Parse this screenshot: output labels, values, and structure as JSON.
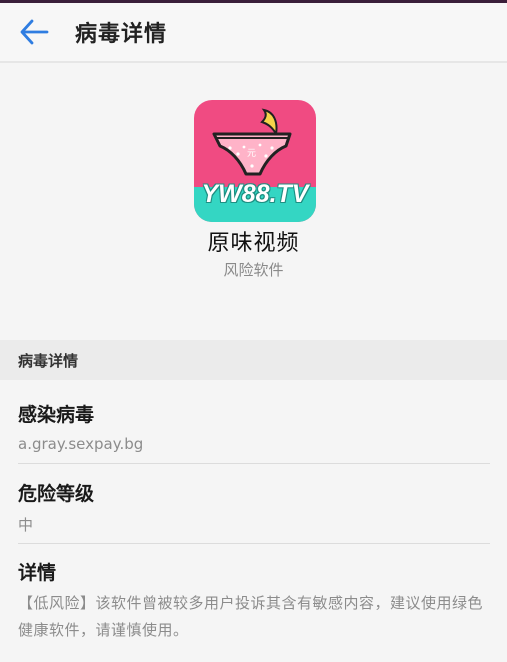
{
  "header": {
    "title": "病毒详情"
  },
  "app": {
    "icon_brand_text": "YW88.TV",
    "name": "原味视频",
    "risk_label": "风险软件"
  },
  "section": {
    "title": "病毒详情"
  },
  "details": {
    "infection": {
      "label": "感染病毒",
      "value": "a.gray.sexpay.bg"
    },
    "risk_level": {
      "label": "危险等级",
      "value": "中"
    },
    "description": {
      "label": "详情",
      "value": "【低风险】该软件曾被较多用户投诉其含有敏感内容，建议使用绿色健康软件，请谨慎使用。"
    }
  },
  "colors": {
    "back_arrow": "#2f7de1",
    "icon_pink": "#f04b82",
    "icon_teal": "#34d6c3"
  }
}
